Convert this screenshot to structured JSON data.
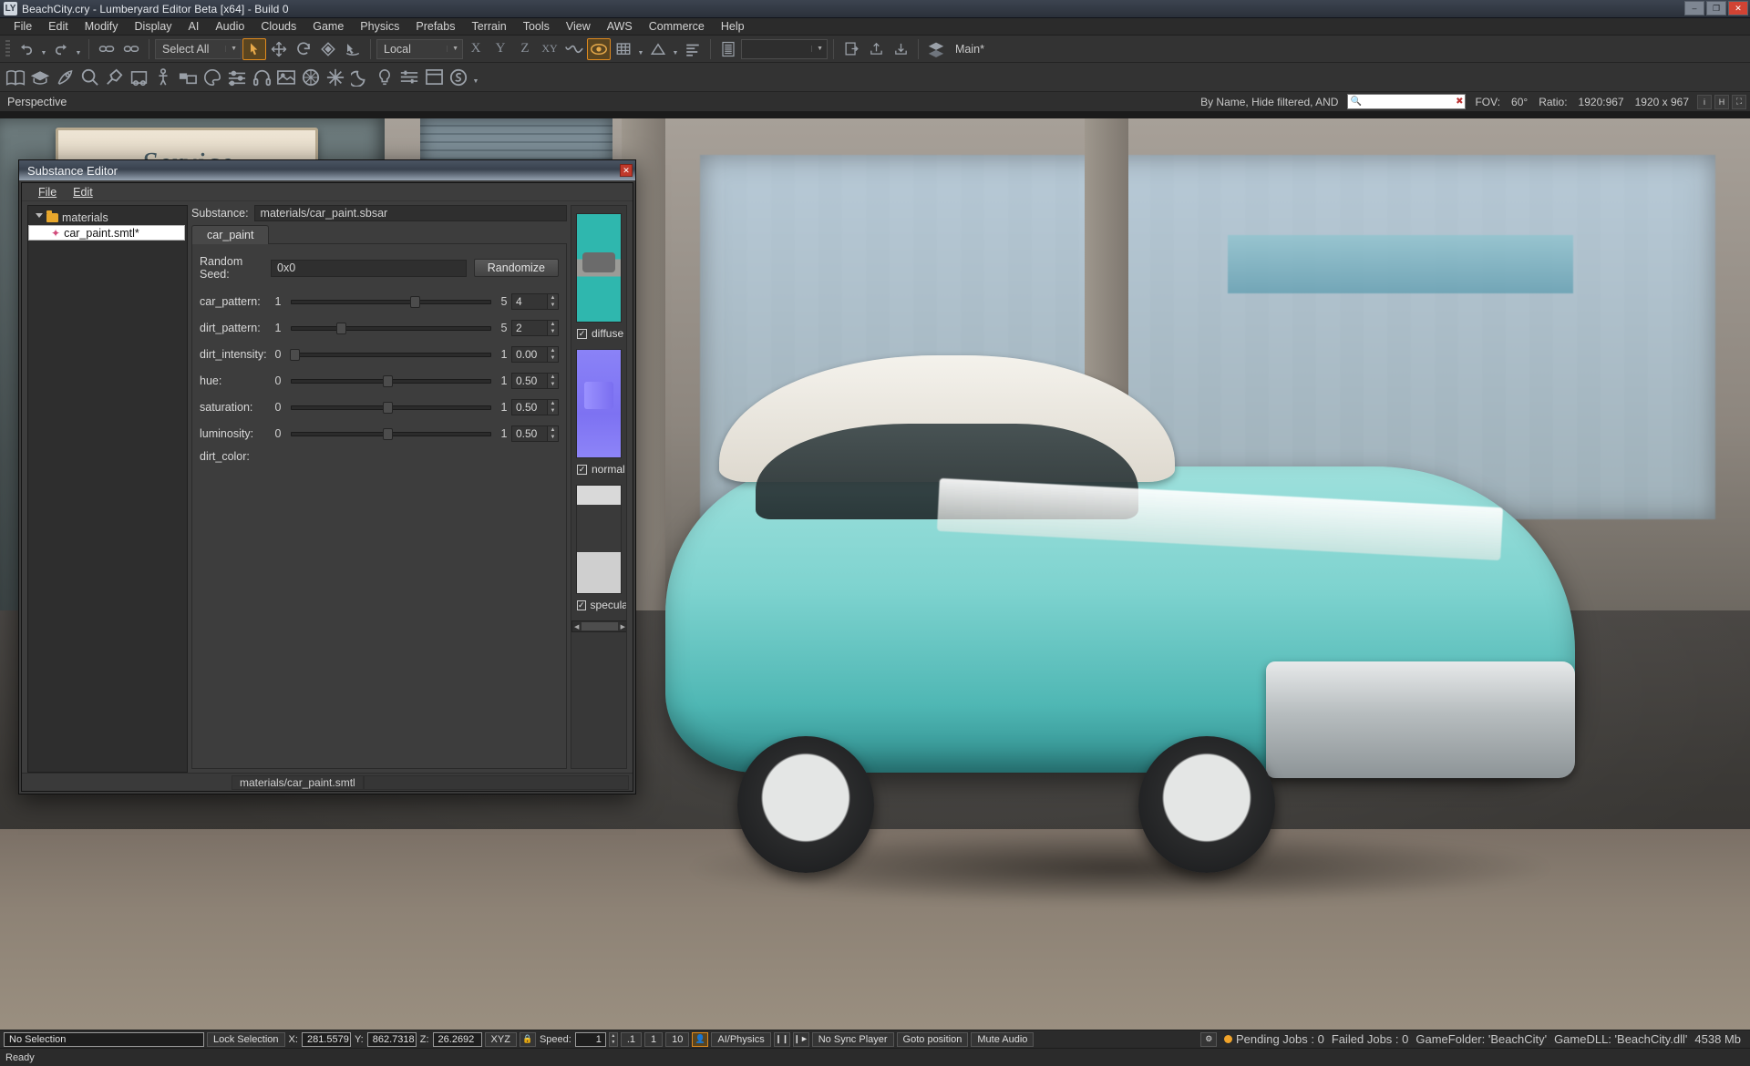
{
  "window": {
    "title": "BeachCity.cry - Lumberyard Editor Beta [x64] - Build 0",
    "app_icon": "lumberyard-icon",
    "minimize": "–",
    "maximize": "❐",
    "close": "✕"
  },
  "menubar": {
    "items": [
      "File",
      "Edit",
      "Modify",
      "Display",
      "AI",
      "Audio",
      "Clouds",
      "Game",
      "Physics",
      "Prefabs",
      "Terrain",
      "Tools",
      "View",
      "AWS",
      "Commerce",
      "Help"
    ]
  },
  "toolbar_row1": {
    "undo_label": "undo-icon",
    "redo_label": "redo-icon",
    "link_label": "link-icon",
    "unlink_label": "unlink-icon",
    "select_combo": "Select All",
    "tools": [
      "select-arrow",
      "move",
      "rotate",
      "scale",
      "terrain-snap"
    ],
    "coord_combo": "Local",
    "axes": [
      "X",
      "Y",
      "Z",
      "XY"
    ],
    "curve_icon": "curve-icon",
    "pivot_icon": "pivot-icon",
    "grid_icon": "grid-snap-icon",
    "angle_icon": "angle-snap-icon",
    "layers_icon": "layers-icon",
    "list_icon": "list-icon",
    "empty_combo": "",
    "goto_icon": "goto-icon",
    "export_icon": "export-icon",
    "import_icon": "import-icon",
    "layer_stack_icon": "layer-stack-icon",
    "main_layer": "Main*"
  },
  "toolbar_row2": {
    "icons": [
      "book-icon",
      "graduation-icon",
      "rocket-icon",
      "magnifier-icon",
      "pin-icon",
      "wheel-icon",
      "character-icon",
      "lighting-icon",
      "palette-icon",
      "sliders-icon",
      "headphones-icon",
      "image-icon",
      "color-wheel-icon",
      "particles-icon",
      "moon-icon",
      "bulb-icon",
      "tracks-icon",
      "window-icon",
      "substance-icon",
      "more-icon"
    ]
  },
  "viewport_header": {
    "label": "Perspective",
    "filter_label": "By Name, Hide filtered, AND",
    "search_placeholder": "",
    "search_icon": "search-icon",
    "clear_icon": "clear-icon",
    "fov_label": "FOV:",
    "fov_value": "60°",
    "ratio_label": "Ratio:",
    "ratio_value": "1920:967",
    "resolution": "1920 x 967",
    "icons": [
      "info-icon",
      "helpers-icon",
      "fullscreen-icon"
    ]
  },
  "dialog": {
    "title": "Substance Editor",
    "close": "✕",
    "menu": [
      "File",
      "Edit"
    ],
    "tree": {
      "root": {
        "label": "materials",
        "icon": "folder-icon",
        "expanded": true
      },
      "children": [
        {
          "label": "car_paint.smtl*",
          "icon": "material-icon",
          "selected": true
        }
      ]
    },
    "substance_label": "Substance:",
    "substance_path": "materials/car_paint.sbsar",
    "tab": "car_paint",
    "random_seed_label": "Random Seed:",
    "random_seed_value": "0x0",
    "randomize_button": "Randomize",
    "params": [
      {
        "name": "car_pattern:",
        "min": "1",
        "max": "5",
        "value": "4",
        "fill": 0.62
      },
      {
        "name": "dirt_pattern:",
        "min": "1",
        "max": "5",
        "value": "2",
        "fill": 0.25
      },
      {
        "name": "dirt_intensity:",
        "min": "0",
        "max": "1",
        "value": "0.00",
        "fill": 0.02
      },
      {
        "name": "hue:",
        "min": "0",
        "max": "1",
        "value": "0.50",
        "fill": 0.48
      },
      {
        "name": "saturation:",
        "min": "0",
        "max": "1",
        "value": "0.50",
        "fill": 0.48
      },
      {
        "name": "luminosity:",
        "min": "0",
        "max": "1",
        "value": "0.50",
        "fill": 0.48
      }
    ],
    "dirt_color_label": "dirt_color:",
    "outputs": [
      {
        "label": "diffuse",
        "checked": true,
        "thumb": "diffuse-thumbnail"
      },
      {
        "label": "normal",
        "checked": true,
        "thumb": "normal-thumbnail"
      },
      {
        "label": "specular",
        "checked": true,
        "thumb": "specular-thumbnail"
      }
    ],
    "status_path": "materials/car_paint.smtl"
  },
  "statusbar": {
    "selection": "No Selection",
    "lock_selection": "Lock Selection",
    "x_label": "X:",
    "x_value": "281.5579",
    "y_label": "Y:",
    "y_value": "862.7318",
    "z_label": "Z:",
    "z_value": "26.2692",
    "xyz_button": "XYZ",
    "lock_icon": "lock-icon",
    "speed_label": "Speed:",
    "speed_value": "1",
    "speed_presets": [
      ".1",
      "1",
      "10"
    ],
    "person_icon": "person-icon",
    "ai_physics": "AI/Physics",
    "pause_icon": "pause-icon",
    "step_icon": "step-icon",
    "sync_player": "No Sync Player",
    "goto_position": "Goto position",
    "mute_audio": "Mute Audio",
    "right_icon": "vcs-icon",
    "pending_jobs": "Pending Jobs : 0",
    "failed_jobs": "Failed Jobs : 0",
    "game_folder": "GameFolder: 'BeachCity'",
    "game_dll": "GameDLL: 'BeachCity.dll'",
    "memory": "4538 Mb",
    "status_dot_color": "#f0a32a"
  },
  "readybar": {
    "text": "Ready"
  }
}
